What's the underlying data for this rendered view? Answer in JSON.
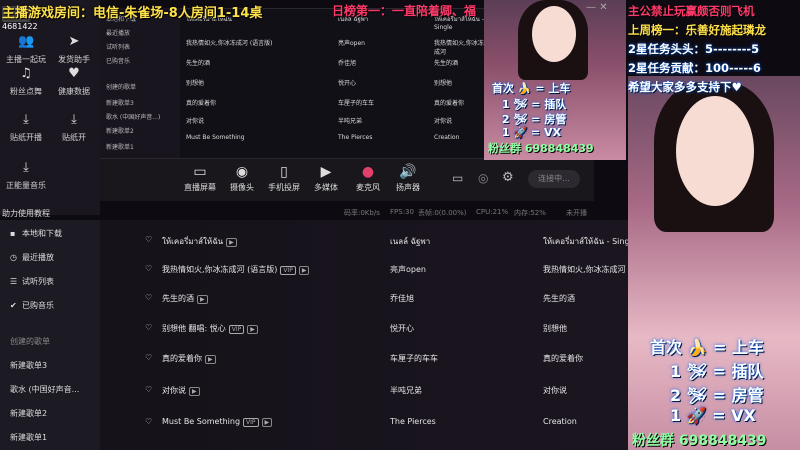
{
  "overlay": {
    "title": "主播游戏房间：电信-朱雀场-8人房间1-14桌",
    "rank": "日榜第一：一直陪着卿、福",
    "room_id": "4681422",
    "right": {
      "line1": "主公禁止玩赢颇否则飞机",
      "line2": "上周榜一：乐善好施起璘龙",
      "line3": "2星任务头头：5--------5",
      "line4": "2星任务贡献：100-----6",
      "line5": "希望大家多多支持下♥"
    },
    "small_caption": {
      "l1": "首次 🍌 = 上车",
      "l2": "1  🛩 = 插队",
      "l3": "2  🛩 = 房管",
      "l4": "1  🚀 = VX",
      "fan": "粉丝群 698848439"
    },
    "big_caption": {
      "l1": "首次 🍌 = 上车",
      "l2": "1  🛩 = 插队",
      "l3": "2  🛩 = 房管",
      "l4": "1  🚀 = VX",
      "fan": "粉丝群 698848439"
    }
  },
  "left_rail": {
    "buttons": [
      {
        "label": "主播一起玩",
        "icon": "users-icon"
      },
      {
        "label": "发货助手",
        "icon": "send-icon"
      },
      {
        "label": "粉丝点舞",
        "icon": "bell-icon"
      },
      {
        "label": "健康数据",
        "icon": "heart-pulse-icon"
      },
      {
        "label": "贴纸开播",
        "icon": "download-icon"
      },
      {
        "label": "贴纸开",
        "icon": "download-icon"
      },
      {
        "label": "正能量音乐",
        "icon": "download-icon"
      }
    ],
    "tutorial": "助力使用教程"
  },
  "mini_player": {
    "sidebar": [
      "本地和下载",
      "最近播放",
      "试听列表",
      "已购音乐",
      "创建的歌单",
      "新建歌单3",
      "歌水 (中国好声音...)",
      "新建歌单2",
      "新建歌单1"
    ],
    "rows": [
      {
        "title": "ให้เคอรี่มาส์ให้ฉัน",
        "artist": "เนลล์ ฉัฐพา",
        "album": "ให้เคอรี่มาส์ให้ฉัน - Single"
      },
      {
        "title": "我热情如火,你冰冻成河 (语言版)",
        "artist": "亮声open",
        "album": "我热情如火,你冰冻成河"
      },
      {
        "title": "先生的酒",
        "artist": "乔佳旭",
        "album": "先生的酒"
      },
      {
        "title": "别想他 ",
        "artist": "悦开心",
        "album": "别想他"
      },
      {
        "title": "真的爱着你",
        "artist": "车厘子的车车",
        "album": "真的爱着你"
      },
      {
        "title": "对你说",
        "artist": "半吨兄弟",
        "album": "对你说"
      },
      {
        "title": "Must Be Something",
        "artist": "The Pierces",
        "album": "Creation"
      }
    ]
  },
  "toolbar": {
    "items": [
      {
        "label": "直播屏幕",
        "icon": "screen-icon"
      },
      {
        "label": "摄像头",
        "icon": "camera-icon"
      },
      {
        "label": "手机投屏",
        "icon": "phone-icon"
      },
      {
        "label": "多媒体",
        "icon": "media-icon"
      },
      {
        "label": "麦克风",
        "icon": "mic-icon"
      },
      {
        "label": "扬声器",
        "icon": "speaker-icon"
      }
    ],
    "connect": "连接中..."
  },
  "status": {
    "bitrate": "码率:0Kb/s",
    "fps": "FPS:30",
    "dropped": "丢帧:0(0.00%)",
    "cpu": "CPU:21%",
    "mem": "内存:52%",
    "live": "未开播"
  },
  "player": {
    "sidebar": [
      {
        "label": "本地和下载",
        "icon": "folder-icon"
      },
      {
        "label": "最近播放",
        "icon": "clock-icon"
      },
      {
        "label": "试听列表",
        "icon": "list-icon"
      },
      {
        "label": "已购音乐",
        "icon": "check-icon"
      },
      {
        "label": "创建的歌单",
        "icon": ""
      },
      {
        "label": "新建歌单3",
        "icon": ""
      },
      {
        "label": "歌水 (中国好声音...",
        "icon": ""
      },
      {
        "label": "新建歌单2",
        "icon": ""
      },
      {
        "label": "新建歌单1",
        "icon": ""
      }
    ],
    "songs": [
      {
        "title": "ให้เคอรี่มาส์ให้ฉัน",
        "tag": "",
        "artist": "เนลล์ ฉัฐพา",
        "album": "ให้เคอรี่มาส์ให้ฉัน - Single"
      },
      {
        "title": "我热情如火,你冰冻成河 (语言版)",
        "tag": "VIP",
        "artist": "亮声open",
        "album": "我热情如火,你冰冻成河"
      },
      {
        "title": "先生的酒",
        "tag": "",
        "artist": "乔佳旭",
        "album": "先生的酒"
      },
      {
        "title": "别想他 翻唱: 悦心",
        "tag": "VIP",
        "artist": "悦开心",
        "album": "别想他"
      },
      {
        "title": "真的爱着你",
        "tag": "",
        "artist": "车厘子的车车",
        "album": "真的爱着你"
      },
      {
        "title": "对你说",
        "tag": "",
        "artist": "半吨兄弟",
        "album": "对你说"
      },
      {
        "title": "Must Be Something",
        "tag": "VIP",
        "artist": "The Pierces",
        "album": "Creation"
      }
    ]
  }
}
